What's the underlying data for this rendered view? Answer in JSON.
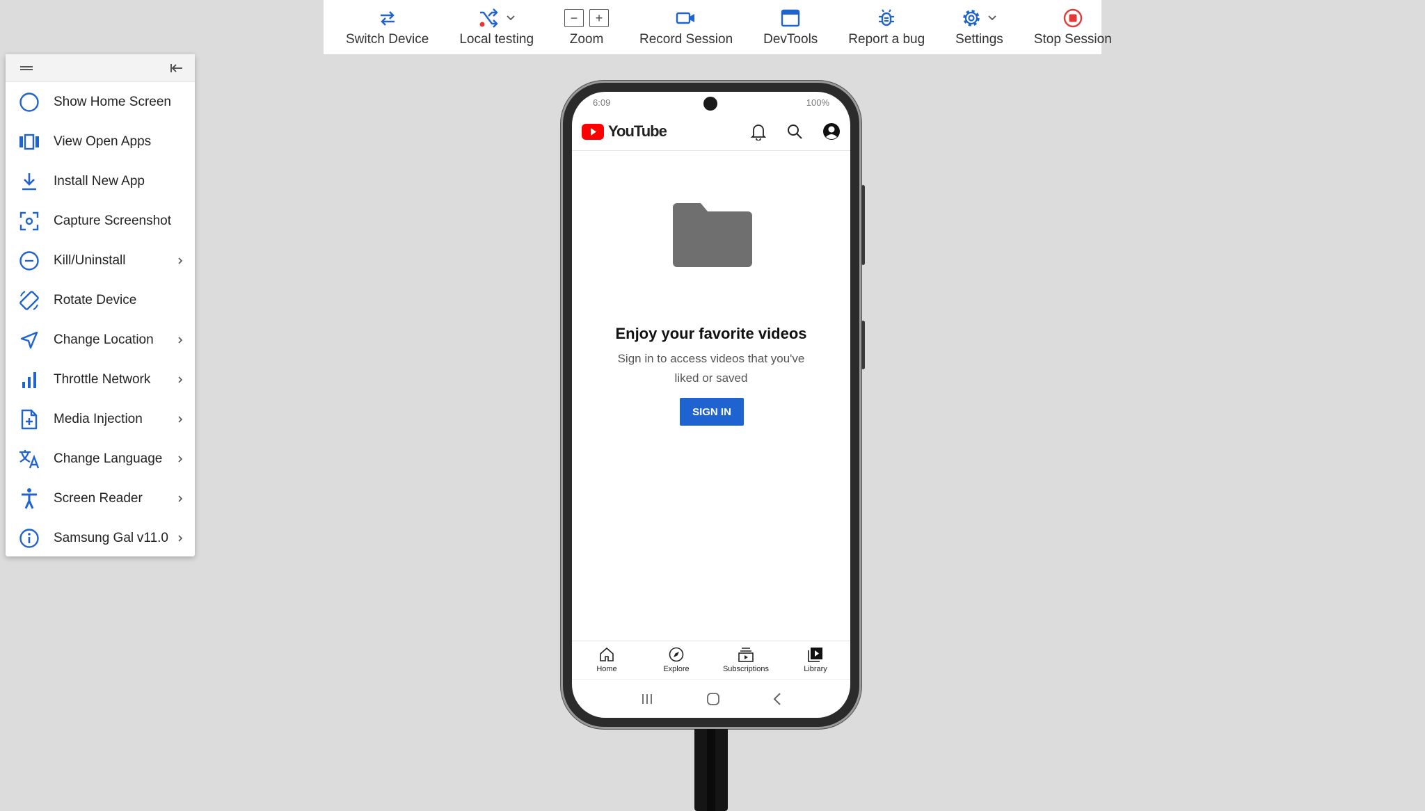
{
  "toolbar": {
    "items": [
      {
        "label": "Switch Device",
        "icon": "switch-arrows-icon"
      },
      {
        "label": "Local testing",
        "icon": "shuffle-icon"
      },
      {
        "label": "Zoom",
        "icon": "zoom-icon",
        "minus": "−",
        "plus": "+"
      },
      {
        "label": "Record Session",
        "icon": "video-camera-icon"
      },
      {
        "label": "DevTools",
        "icon": "window-icon"
      },
      {
        "label": "Report a bug",
        "icon": "bug-icon"
      },
      {
        "label": "Settings",
        "icon": "gear-icon"
      },
      {
        "label": "Stop Session",
        "icon": "stop-circle-icon"
      }
    ]
  },
  "sidebar": {
    "items": [
      {
        "label": "Show Home Screen",
        "icon": "circle-icon"
      },
      {
        "label": "View Open Apps",
        "icon": "open-apps-icon"
      },
      {
        "label": "Install New App",
        "icon": "download-icon"
      },
      {
        "label": "Capture Screenshot",
        "icon": "screenshot-icon"
      },
      {
        "label": "Kill/Uninstall",
        "icon": "minus-circle-icon"
      },
      {
        "label": "Rotate Device",
        "icon": "rotate-icon"
      },
      {
        "label": "Change Location",
        "icon": "location-arrow-icon"
      },
      {
        "label": "Throttle Network",
        "icon": "bar-chart-icon"
      },
      {
        "label": "Media Injection",
        "icon": "file-plus-icon"
      },
      {
        "label": "Change Language",
        "icon": "translate-icon"
      },
      {
        "label": "Screen Reader",
        "icon": "accessibility-icon"
      },
      {
        "label": "Samsung Gal",
        "version": "v11.0",
        "icon": "info-icon"
      }
    ]
  },
  "phone": {
    "status_time": "6:09",
    "status_battery": "100%",
    "app_name": "YouTube",
    "empty_title": "Enjoy your favorite videos",
    "empty_subtitle": "Sign in to access videos that you've liked or saved",
    "sign_in_label": "SIGN IN",
    "nav": [
      "Home",
      "Explore",
      "Subscriptions",
      "Library"
    ]
  },
  "colors": {
    "accent_blue": "#1f63d1",
    "stop_red": "#e53935",
    "youtube_red": "#ff0000"
  }
}
